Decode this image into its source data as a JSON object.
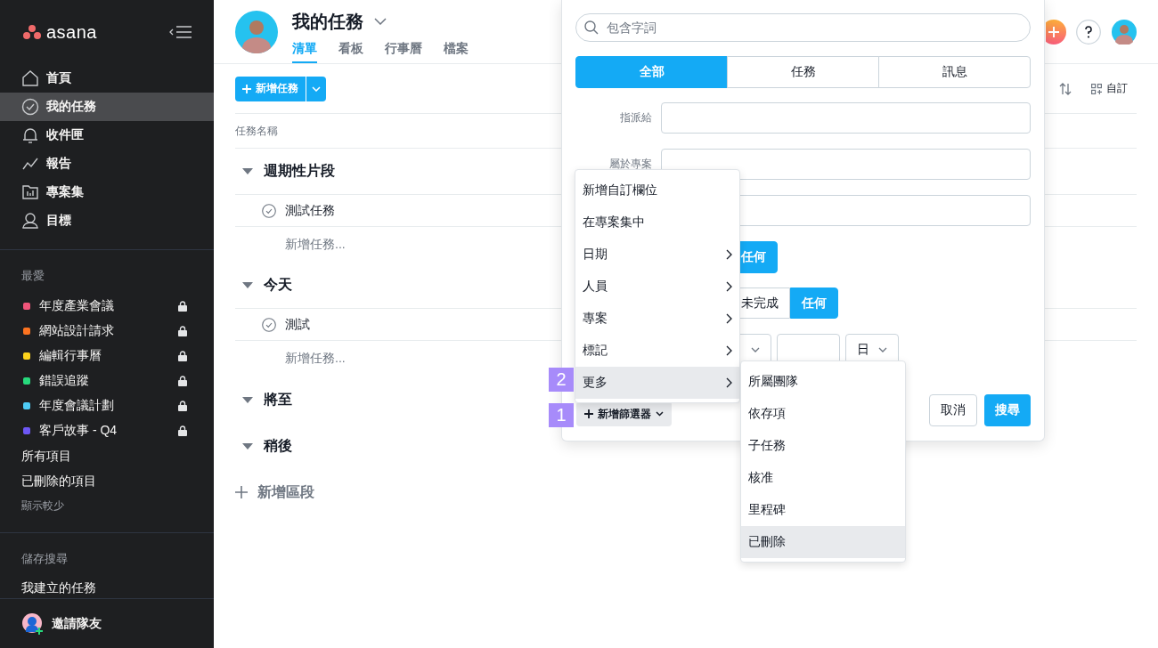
{
  "sidebar": {
    "logo": "asana",
    "nav": [
      {
        "label": "首頁",
        "selected": false
      },
      {
        "label": "我的任務",
        "selected": true
      },
      {
        "label": "收件匣",
        "selected": false
      },
      {
        "label": "報告",
        "selected": false
      },
      {
        "label": "專案集",
        "selected": false
      },
      {
        "label": "目標",
        "selected": false
      }
    ],
    "favorites_heading": "最愛",
    "favorites": [
      {
        "label": "年度產業會議",
        "color": "#f0557a",
        "private": true
      },
      {
        "label": "網站設計請求",
        "color": "#fc7320",
        "private": true
      },
      {
        "label": "編輯行事曆",
        "color": "#fcd21c",
        "private": true
      },
      {
        "label": "錯誤追蹤",
        "color": "#27d97c",
        "private": true
      },
      {
        "label": "年度會議計劃",
        "color": "#4ecbf5",
        "private": true
      },
      {
        "label": "客戶故事 - Q4",
        "color": "#6d57f5",
        "private": true
      }
    ],
    "links": [
      "所有項目",
      "已刪除的項目"
    ],
    "show_less": "顯示較少",
    "saved_heading": "儲存搜尋",
    "saved": [
      "我建立的任務"
    ],
    "invite": "邀請隊友"
  },
  "header": {
    "title": "我的任務",
    "tabs": [
      {
        "label": "清單",
        "selected": true
      },
      {
        "label": "看板",
        "selected": false
      },
      {
        "label": "行事曆",
        "selected": false
      },
      {
        "label": "檔案",
        "selected": false
      }
    ]
  },
  "toolbar": {
    "add_task": "新增任務",
    "customize": "自訂"
  },
  "list": {
    "column": "任務名稱",
    "sections": [
      {
        "title": "週期性片段",
        "expanded": true,
        "tasks": [
          {
            "name": "測試任務",
            "completed": false
          }
        ],
        "add_task": "新增任務..."
      },
      {
        "title": "今天",
        "expanded": true,
        "tasks": [
          {
            "name": "測試",
            "completed": false
          }
        ],
        "add_task": "新增任務..."
      },
      {
        "title": "將至",
        "expanded": true
      },
      {
        "title": "稍後",
        "expanded": true
      }
    ],
    "add_section": "新增區段"
  },
  "search_panel": {
    "placeholder": "包含字詞",
    "scopes": [
      {
        "label": "全部",
        "selected": true
      },
      {
        "label": "任務",
        "selected": false
      },
      {
        "label": "訊息",
        "selected": false
      }
    ],
    "fields": [
      {
        "kind": "labeled",
        "label": "指派給"
      },
      {
        "kind": "labeled",
        "label": "屬於專案"
      },
      {
        "kind": "plain"
      }
    ],
    "project_toggle": [
      {
        "label": "任何",
        "selected": true
      }
    ],
    "completion": [
      {
        "label": "未完成",
        "selected": false
      },
      {
        "label": "任何",
        "selected": true
      }
    ],
    "date_controls": [
      {
        "kind": "dropdown"
      },
      {
        "kind": "box"
      },
      {
        "kind": "dropdown",
        "value": "日"
      }
    ],
    "add_filter": "新增篩選器",
    "cancel": "取消",
    "search": "搜尋"
  },
  "filter_menu": [
    {
      "label": "新增自訂欄位",
      "submenu": false,
      "selected": false
    },
    {
      "label": "在專案集中",
      "submenu": false,
      "selected": false
    },
    {
      "label": "日期",
      "submenu": true,
      "selected": false
    },
    {
      "label": "人員",
      "submenu": true,
      "selected": false
    },
    {
      "label": "專案",
      "submenu": true,
      "selected": false
    },
    {
      "label": "標記",
      "submenu": true,
      "selected": false
    },
    {
      "label": "更多",
      "submenu": true,
      "selected": true
    }
  ],
  "more_menu": [
    {
      "label": "所屬團隊",
      "selected": false
    },
    {
      "label": "依存項",
      "selected": false
    },
    {
      "label": "子任務",
      "selected": false
    },
    {
      "label": "核准",
      "selected": false
    },
    {
      "label": "里程碑",
      "selected": false
    },
    {
      "label": "已刪除",
      "selected": true
    }
  ],
  "callouts": [
    "2",
    "1"
  ]
}
